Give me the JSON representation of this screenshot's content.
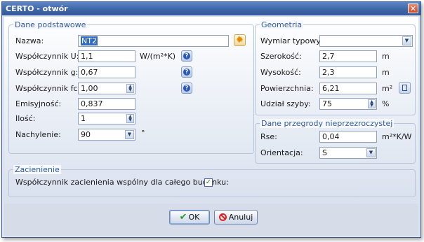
{
  "window": {
    "title": "CERTO - otwór",
    "close_glyph": "✕"
  },
  "basic": {
    "title": "Dane podstawowe",
    "name_label": "Nazwa:",
    "name_value": "NT2",
    "u_label": "Współczynnik U:",
    "u_value": "1,1",
    "u_unit": "W/(m²*K)",
    "g_label": "Współczynnik g:",
    "g_value": "0,67",
    "fc_label": "Współczynnik fc:",
    "fc_value": "1,00",
    "emis_label": "Emisyjność:",
    "emis_value": "0,837",
    "qty_label": "Ilość:",
    "qty_value": "1",
    "tilt_label": "Nachylenie:",
    "tilt_value": "90",
    "tilt_unit": "°",
    "help_glyph": "?",
    "sun_glyph": "✹"
  },
  "geometry": {
    "title": "Geometria",
    "type_label": "Wymiar typowy:",
    "type_value": "",
    "width_label": "Szerokość:",
    "width_value": "2,7",
    "width_unit": "m",
    "height_label": "Wysokość:",
    "height_value": "2,3",
    "height_unit": "m",
    "area_label": "Powierzchnia:",
    "area_value": "6,21",
    "area_unit": "m²",
    "glass_label": "Udział szyby:",
    "glass_value": "75",
    "glass_unit": "%"
  },
  "opaque": {
    "title": "Dane przegrody nieprzezroczystej",
    "rse_label": "Rse:",
    "rse_value": "0,04",
    "rse_unit": "m²*K/W",
    "orient_label": "Orientacja:",
    "orient_value": "S"
  },
  "shading": {
    "title": "Zacienienie",
    "shared_label": "Współczynnik zacienienia wspólny dla całego budynku:",
    "shared_checked": true,
    "check_glyph": "✓"
  },
  "buttons": {
    "ok_label": "OK",
    "cancel_label": "Anuluj",
    "ok_glyph": "✔"
  },
  "colors": {
    "accent": "#2f5aa0",
    "title_bar": "#3f66a8",
    "selection": "#316ac5"
  }
}
